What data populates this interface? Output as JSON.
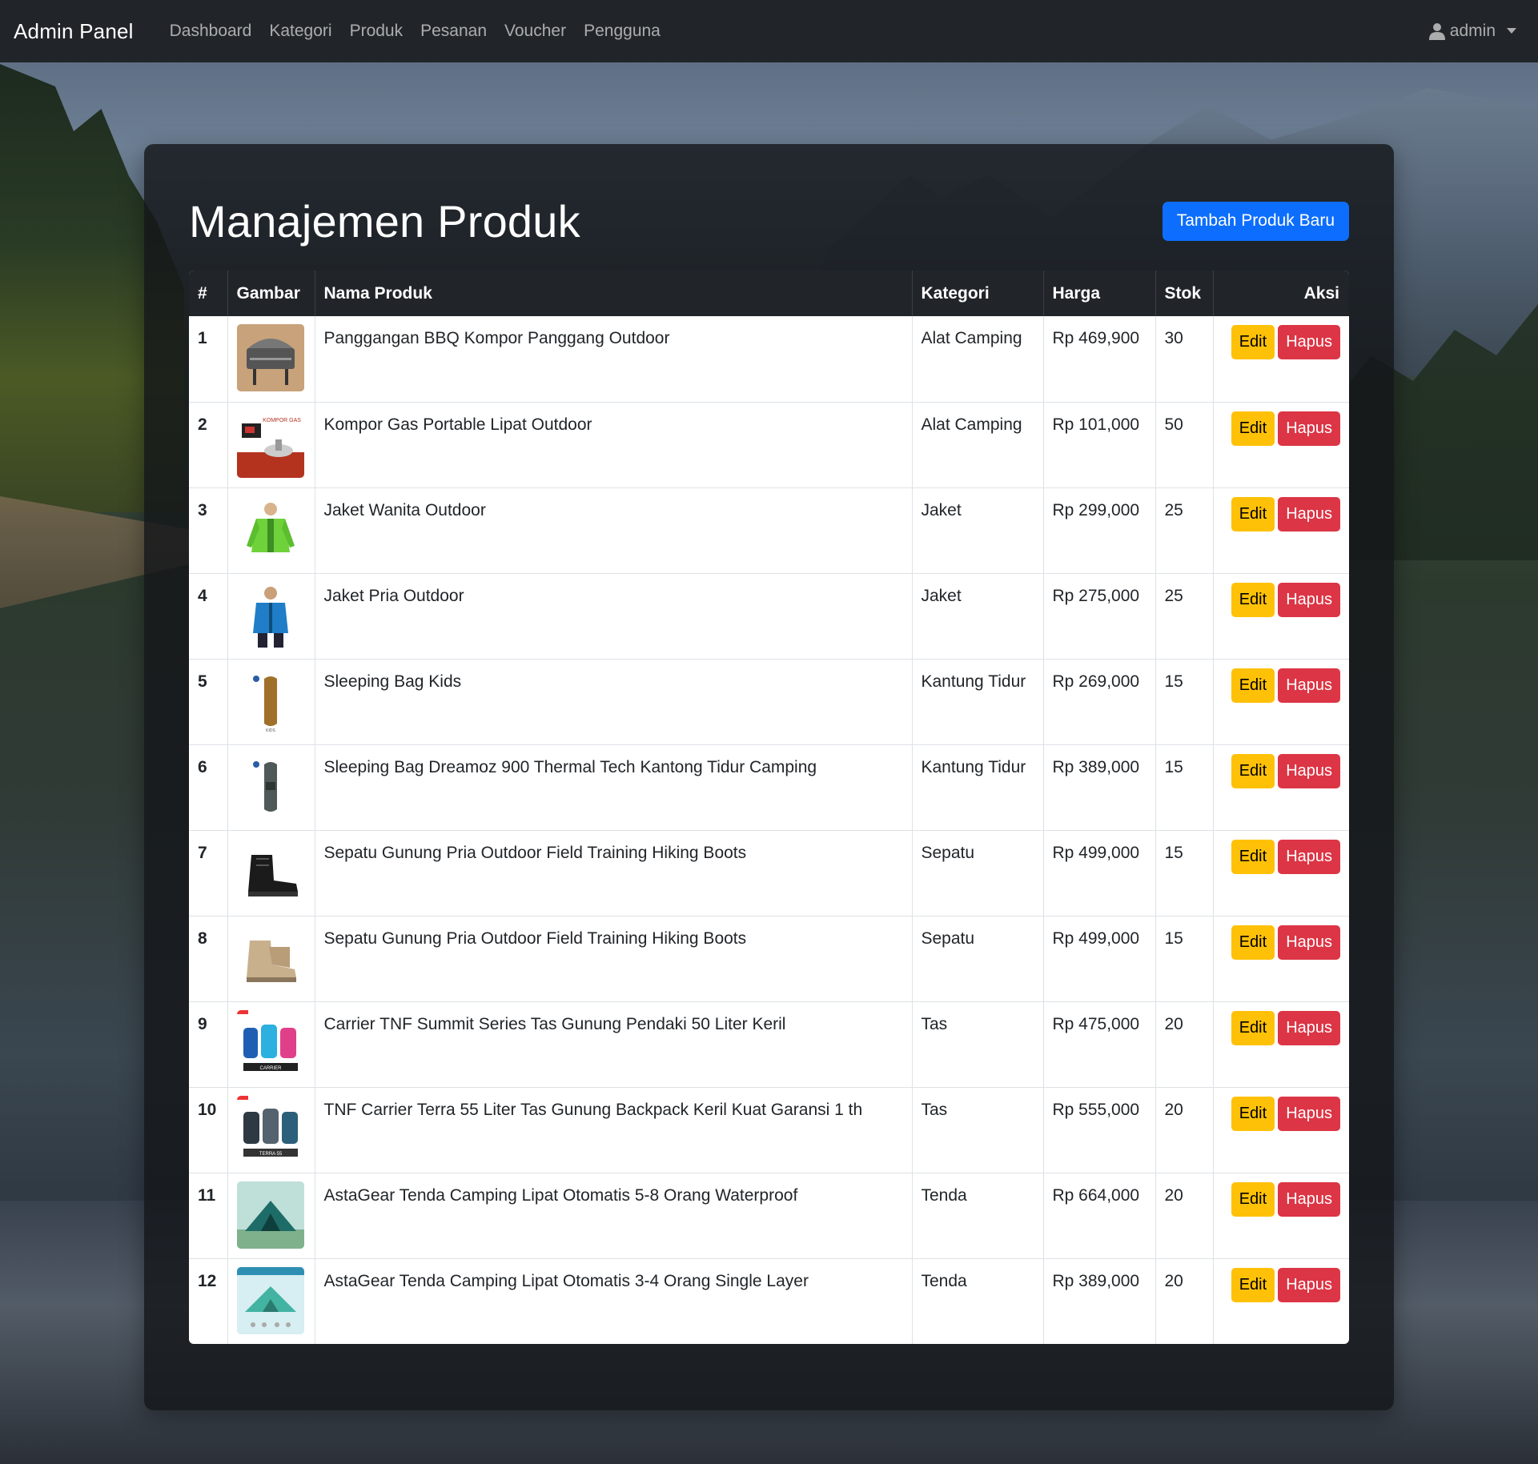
{
  "navbar": {
    "brand": "Admin Panel",
    "links": [
      "Dashboard",
      "Kategori",
      "Produk",
      "Pesanan",
      "Voucher",
      "Pengguna"
    ],
    "user": "admin",
    "user_icon": "user-icon",
    "caret_icon": "caret-down-icon"
  },
  "page": {
    "title": "Manajemen Produk",
    "add_button": "Tambah Produk Baru"
  },
  "table": {
    "headers": [
      "#",
      "Gambar",
      "Nama Produk",
      "Kategori",
      "Harga",
      "Stok",
      "Aksi"
    ],
    "edit_label": "Edit",
    "delete_label": "Hapus",
    "rows": [
      {
        "no": "1",
        "name": "Panggangan BBQ Kompor Panggang Outdoor",
        "category": "Alat Camping",
        "price": "Rp 469,900",
        "stock": "30",
        "thumb": "bbq-grill"
      },
      {
        "no": "2",
        "name": "Kompor Gas Portable Lipat Outdoor",
        "category": "Alat Camping",
        "price": "Rp 101,000",
        "stock": "50",
        "thumb": "gas-stove"
      },
      {
        "no": "3",
        "name": "Jaket Wanita Outdoor",
        "category": "Jaket",
        "price": "Rp 299,000",
        "stock": "25",
        "thumb": "green-jacket"
      },
      {
        "no": "4",
        "name": "Jaket Pria Outdoor",
        "category": "Jaket",
        "price": "Rp 275,000",
        "stock": "25",
        "thumb": "blue-jacket"
      },
      {
        "no": "5",
        "name": "Sleeping Bag Kids",
        "category": "Kantung Tidur",
        "price": "Rp 269,000",
        "stock": "15",
        "thumb": "sleeping-bag-brown"
      },
      {
        "no": "6",
        "name": "Sleeping Bag Dreamoz 900 Thermal Tech Kantong Tidur Camping",
        "category": "Kantung Tidur",
        "price": "Rp 389,000",
        "stock": "15",
        "thumb": "sleeping-bag-grey"
      },
      {
        "no": "7",
        "name": "Sepatu Gunung Pria Outdoor Field Training Hiking Boots",
        "category": "Sepatu",
        "price": "Rp 499,000",
        "stock": "15",
        "thumb": "black-boots"
      },
      {
        "no": "8",
        "name": "Sepatu Gunung Pria Outdoor Field Training Hiking Boots",
        "category": "Sepatu",
        "price": "Rp 499,000",
        "stock": "15",
        "thumb": "tan-boots"
      },
      {
        "no": "9",
        "name": "Carrier TNF Summit Series Tas Gunung Pendaki 50 Liter Keril",
        "category": "Tas",
        "price": "Rp 475,000",
        "stock": "20",
        "thumb": "backpacks-colorful"
      },
      {
        "no": "10",
        "name": "TNF Carrier Terra 55 Liter Tas Gunung Backpack Keril Kuat Garansi 1 th",
        "category": "Tas",
        "price": "Rp 555,000",
        "stock": "20",
        "thumb": "backpacks-dark"
      },
      {
        "no": "11",
        "name": "AstaGear Tenda Camping Lipat Otomatis 5-8 Orang Waterproof",
        "category": "Tenda",
        "price": "Rp 664,000",
        "stock": "20",
        "thumb": "tent-large"
      },
      {
        "no": "12",
        "name": "AstaGear Tenda Camping Lipat Otomatis 3-4 Orang Single Layer",
        "category": "Tenda",
        "price": "Rp 389,000",
        "stock": "20",
        "thumb": "tent-small"
      }
    ]
  },
  "colors": {
    "navbar": "#212529",
    "primary": "#0d6efd",
    "warning": "#ffc107",
    "danger": "#dc3545"
  }
}
